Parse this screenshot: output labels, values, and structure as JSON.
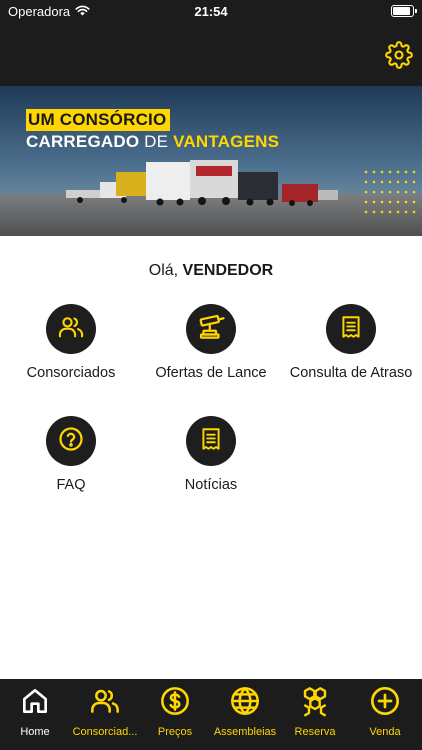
{
  "status_bar": {
    "carrier": "Operadora",
    "time": "21:54"
  },
  "banner": {
    "line1": "UM CONSÓRCIO",
    "line2_part1": "CARREGADO",
    "line2_part2": " DE ",
    "line2_part3": "VANTAGENS"
  },
  "greeting": {
    "prefix": "Olá, ",
    "name": "VENDEDOR"
  },
  "menu": [
    {
      "label": "Consorciados",
      "icon": "users-icon"
    },
    {
      "label": "Ofertas de Lance",
      "icon": "gavel-icon"
    },
    {
      "label": "Consulta de Atraso",
      "icon": "receipt-icon"
    },
    {
      "label": "FAQ",
      "icon": "question-icon"
    },
    {
      "label": "Notícias",
      "icon": "receipt-icon"
    }
  ],
  "tabs": [
    {
      "label": "Home",
      "icon": "home-icon",
      "active": true
    },
    {
      "label": "Consorciad...",
      "icon": "users-icon"
    },
    {
      "label": "Preços",
      "icon": "dollar-icon"
    },
    {
      "label": "Assembleias",
      "icon": "globe-icon"
    },
    {
      "label": "Reserva",
      "icon": "hexagons-icon"
    },
    {
      "label": "Venda",
      "icon": "plus-circle-icon"
    }
  ],
  "colors": {
    "accent": "#ffd600",
    "dark": "#1c1c1c",
    "circle": "#1e1e1e"
  }
}
